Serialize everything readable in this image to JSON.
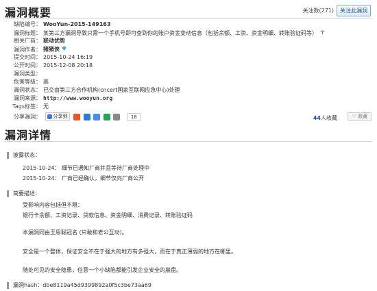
{
  "overview": {
    "title": "漏洞概要",
    "follow_count": "关注数(271)",
    "follow_button": "关注此漏洞",
    "fields": [
      {
        "key": "缺陷编号：",
        "value": "WooYun-2015-149163"
      },
      {
        "key": "漏洞标题：",
        "value": "某第三方漏洞导致只需一个手机号即可查到你的账户资金变动信息（包括余额、工资、资金明细、转账验证码等）"
      },
      {
        "key": "相关厂商：",
        "value": "联动优势"
      },
      {
        "key": "漏洞作者：",
        "value": "猪猪侠"
      },
      {
        "key": "提交时间：",
        "value": "2015-10-24 16:19"
      },
      {
        "key": "公开时间：",
        "value": "2015-12-08 20:18"
      },
      {
        "key": "漏洞类型：",
        "value": ""
      },
      {
        "key": "危害等级：",
        "value": "高"
      },
      {
        "key": "漏洞状态：",
        "value": "已交由第三方合作机构(cncert国家互联网应急中心)处理"
      },
      {
        "key": "漏洞来源：",
        "value": "http://www.wooyun.org"
      },
      {
        "key": "Tags标签：",
        "value": "无"
      }
    ],
    "share": {
      "label": "分享漏洞：",
      "share_to": "分享到",
      "count": "18",
      "likes_prefix": "44",
      "likes_suffix": "人收藏",
      "favorite": "收藏"
    }
  },
  "details": {
    "title": "漏洞详情",
    "disclosure_label": "披露状态：",
    "timeline": [
      "2015-10-24：  细节已通知厂商并且等待厂商处理中",
      "2015-10-24：  厂商已经确认，细节仅向厂商公开"
    ],
    "summary_label": "简要描述：",
    "summary_lines": [
      "受影响内容包括但不限：",
      "银行卡余额、工资记录、贷款信息、资金明细、消费记录、转账验证码",
      "本漏洞同由王思聪冠名  (只敢和老公互动)。",
      "安全是一个整体，保证安全不在于强大的地方有多强大，而在于真正薄弱的地方在哪里。",
      "随处可见的安全隐患，任意一个小缺陷都能引发企业安全的崩盘。"
    ],
    "hash": "漏洞hash：dbe8119a45d9399892a0f5c3be73aa69"
  },
  "colors": {
    "link": "#1f4f9a",
    "rule": "#cfcfcf"
  }
}
